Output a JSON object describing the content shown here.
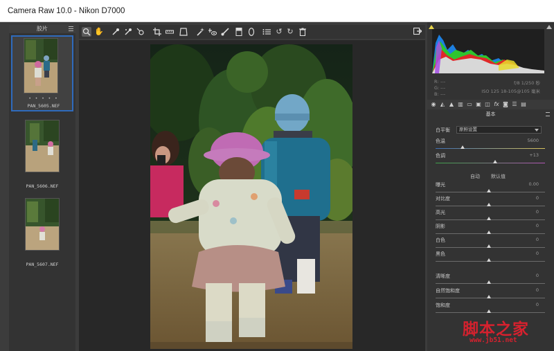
{
  "window": {
    "title": "Camera Raw 10.0 -  Nikon D7000"
  },
  "filmstrip": {
    "header": "胶片",
    "items": [
      {
        "name": "PAN_5605.NEF",
        "rating": "• • • • •",
        "selected": true
      },
      {
        "name": "PAN_5606.NEF",
        "selected": false
      },
      {
        "name": "PAN_5607.NEF",
        "selected": false
      }
    ]
  },
  "toolbar": {
    "icons": [
      "zoom-icon",
      "hand-icon",
      "white-balance-icon",
      "color-sampler-icon",
      "target-adjust-icon",
      "crop-icon",
      "straighten-icon",
      "transform-icon",
      "spot-removal-icon",
      "red-eye-icon",
      "adjustment-brush-icon",
      "graduated-filter-icon",
      "radial-filter-icon",
      "preferences-icon",
      "rotate-ccw-icon",
      "rotate-cw-icon",
      "trash-icon",
      "export-icon"
    ]
  },
  "info": {
    "r_label": "R:",
    "g_label": "G:",
    "b_label": "B:",
    "dash": "---",
    "aperture_shutter": "f/8   1/250 秒",
    "iso_lens": "ISO 125   18-105@105 毫米"
  },
  "panel": {
    "section_title": "基本",
    "white_balance_label": "白平衡",
    "white_balance_value": "原照设置",
    "temperature_label": "色温",
    "temperature_value": "5600",
    "tint_label": "色调",
    "tint_value": "+13",
    "auto_link": "自动",
    "default_link": "默认值",
    "exposure_label": "曝光",
    "exposure_value": "0.00",
    "contrast_label": "对比度",
    "contrast_value": "0",
    "highlights_label": "高光",
    "highlights_value": "0",
    "shadows_label": "阴影",
    "shadows_value": "0",
    "whites_label": "白色",
    "whites_value": "0",
    "blacks_label": "黑色",
    "blacks_value": "0",
    "clarity_label": "清晰度",
    "clarity_value": "0",
    "vibrance_label": "自然饱和度",
    "vibrance_value": "0",
    "saturation_label": "饱和度",
    "saturation_value": "0"
  },
  "watermark": {
    "text": "脚本之家",
    "url": "www.jb51.net"
  },
  "colors": {
    "accent": "#2f6bbd",
    "watermark": "#d6212e"
  }
}
